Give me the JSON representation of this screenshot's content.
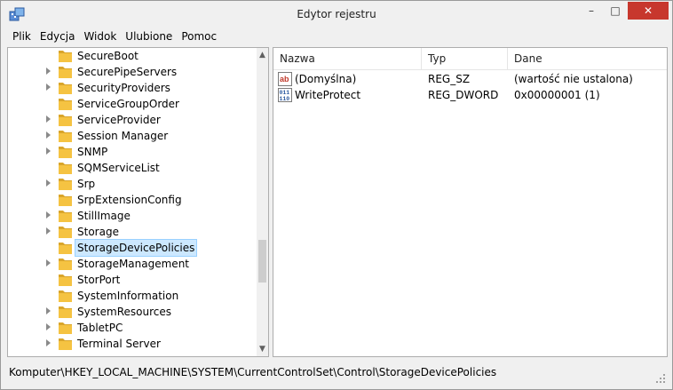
{
  "window": {
    "title": "Edytor rejestru",
    "buttons": {
      "minimize": "–",
      "maximize": "□",
      "close": "✕"
    }
  },
  "menu": [
    "Plik",
    "Edycja",
    "Widok",
    "Ulubione",
    "Pomoc"
  ],
  "tree": {
    "items": [
      {
        "label": "SecureBoot",
        "expandable": false
      },
      {
        "label": "SecurePipeServers",
        "expandable": true
      },
      {
        "label": "SecurityProviders",
        "expandable": true
      },
      {
        "label": "ServiceGroupOrder",
        "expandable": false
      },
      {
        "label": "ServiceProvider",
        "expandable": true
      },
      {
        "label": "Session Manager",
        "expandable": true
      },
      {
        "label": "SNMP",
        "expandable": true
      },
      {
        "label": "SQMServiceList",
        "expandable": false
      },
      {
        "label": "Srp",
        "expandable": true
      },
      {
        "label": "SrpExtensionConfig",
        "expandable": false
      },
      {
        "label": "StillImage",
        "expandable": true
      },
      {
        "label": "Storage",
        "expandable": true
      },
      {
        "label": "StorageDevicePolicies",
        "expandable": false,
        "selected": true
      },
      {
        "label": "StorageManagement",
        "expandable": true
      },
      {
        "label": "StorPort",
        "expandable": false
      },
      {
        "label": "SystemInformation",
        "expandable": false
      },
      {
        "label": "SystemResources",
        "expandable": true
      },
      {
        "label": "TabletPC",
        "expandable": true
      },
      {
        "label": "Terminal Server",
        "expandable": true
      }
    ]
  },
  "list": {
    "columns": [
      "Nazwa",
      "Typ",
      "Dane"
    ],
    "rows": [
      {
        "icon": "string-value-icon",
        "name": "(Domyślna)",
        "type": "REG_SZ",
        "data": "(wartość nie ustalona)"
      },
      {
        "icon": "binary-value-icon",
        "name": "WriteProtect",
        "type": "REG_DWORD",
        "data": "0x00000001 (1)"
      }
    ]
  },
  "status": {
    "path": "Komputer\\HKEY_LOCAL_MACHINE\\SYSTEM\\CurrentControlSet\\Control\\StorageDevicePolicies"
  },
  "colors": {
    "selection": "#cce8ff",
    "close_button": "#c7372d",
    "folder": "#f5c342"
  }
}
